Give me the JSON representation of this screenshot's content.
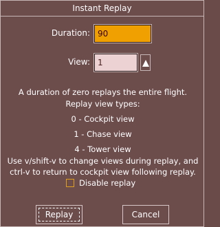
{
  "window": {
    "title": "Instant Replay"
  },
  "form": {
    "duration_label": "Duration:",
    "duration_value": "90",
    "view_label": "View:",
    "view_value": "1"
  },
  "help": {
    "line1": "A duration of zero replays the entire flight.",
    "line2": "Replay view types:",
    "view0": "0  -  Cockpit view",
    "view1": "1  -  Chase view",
    "view4": "4  -  Tower view",
    "line3": "Use v/shift-v to change views during replay, and",
    "line4": "ctrl-v to return to cockpit view following replay."
  },
  "options": {
    "disable_replay_label": "Disable replay",
    "disable_replay_checked": false
  },
  "buttons": {
    "replay": "Replay",
    "cancel": "Cancel"
  },
  "icons": {
    "spin_up": "triangle-up-icon"
  },
  "colors": {
    "background": "#6d4c4c",
    "duration_field": "#f0a000",
    "view_field": "#ecd2d2"
  }
}
